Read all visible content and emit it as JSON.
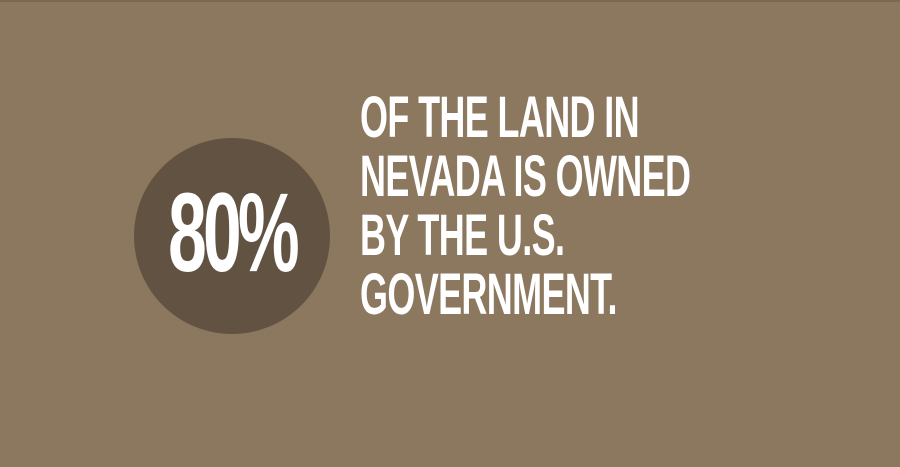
{
  "colors": {
    "background": "#8c775f",
    "circle": "#625242",
    "text": "#ffffff"
  },
  "stat": {
    "value": "80%"
  },
  "fact": {
    "lines": [
      "OF THE LAND IN",
      "NEVADA IS OWNED",
      "BY THE U.S.",
      "GOVERNMENT."
    ]
  }
}
